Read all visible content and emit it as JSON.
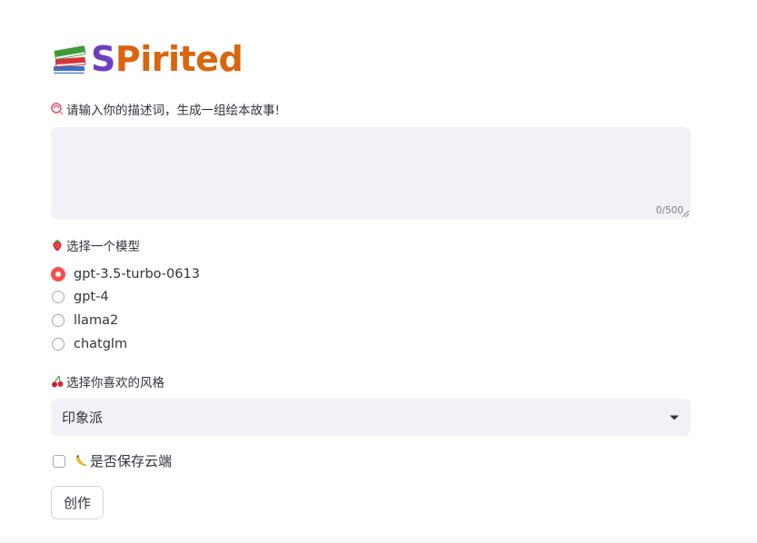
{
  "app": {
    "title_first_letter": "S",
    "title_rest": "Pirited",
    "title_icon": "books-icon"
  },
  "prompt": {
    "label": "请输入你的描述词，生成一组绘本故事!",
    "icon": "lollipop-icon",
    "value": "",
    "char_count": "0/500"
  },
  "model": {
    "label": "选择一个模型",
    "icon": "strawberry-icon",
    "options": [
      "gpt-3.5-turbo-0613",
      "gpt-4",
      "llama2",
      "chatglm"
    ],
    "selected": "gpt-3.5-turbo-0613"
  },
  "style": {
    "label": "选择你喜欢的风格",
    "icon": "cherries-icon",
    "selected": "印象派"
  },
  "save": {
    "label": "是否保存云端",
    "icon": "banana-icon",
    "checked": false
  },
  "create_button": {
    "label": "创作"
  },
  "colors": {
    "accent": "#ff4b4b",
    "title_s": "#6d3fc0",
    "title_rest": "#d9650f",
    "input_bg": "#f0f2f6",
    "text": "#31333f"
  }
}
